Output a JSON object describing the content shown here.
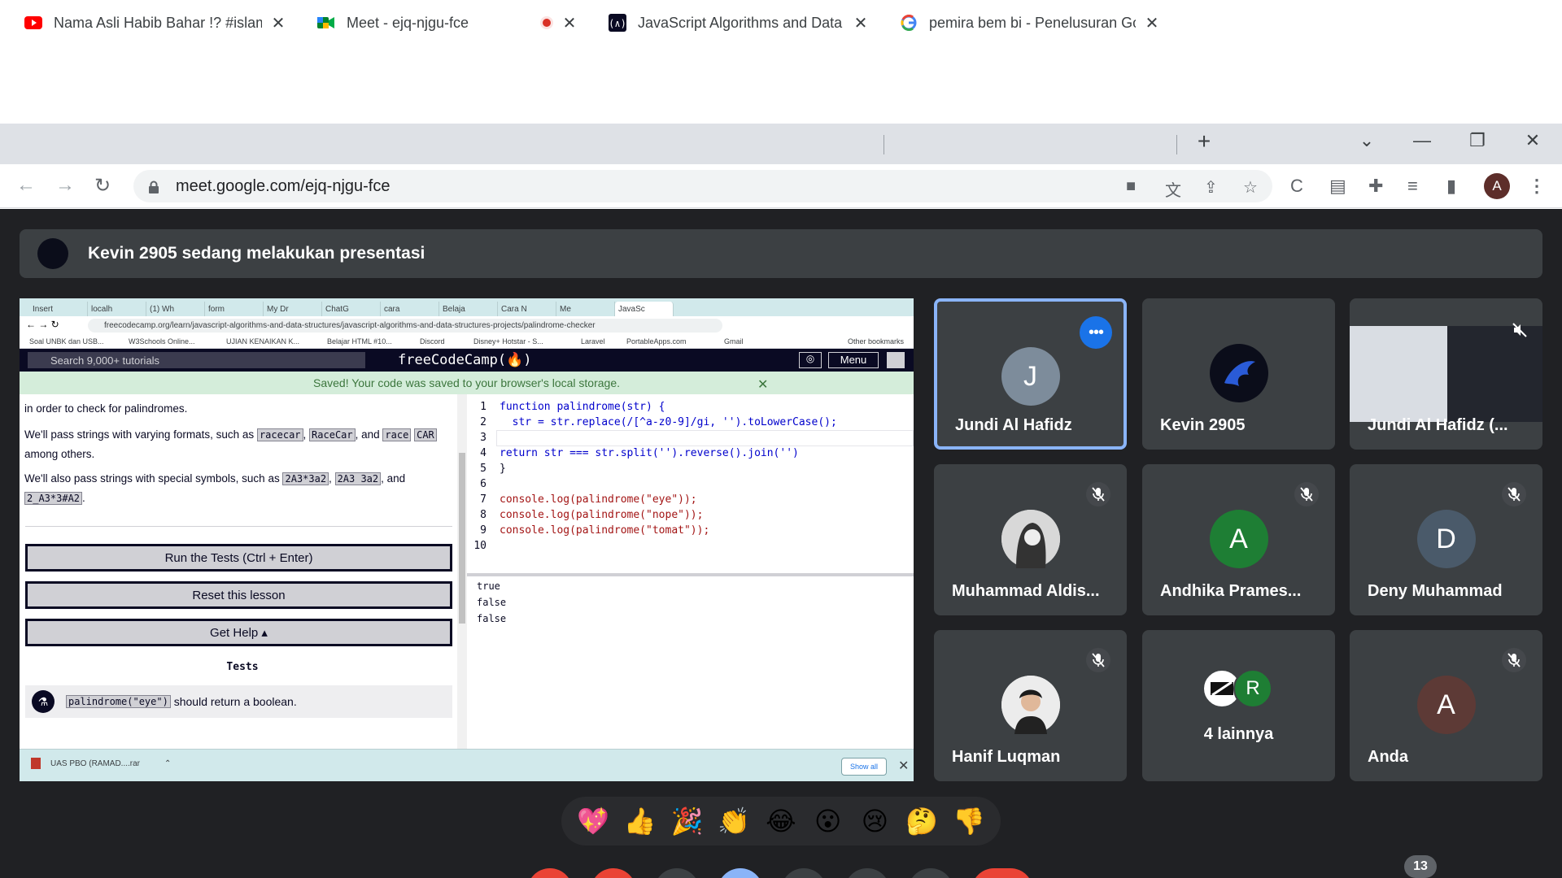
{
  "browser": {
    "tabs": [
      {
        "title": "Nama Asli Habib Bahar !? #islam",
        "icon": "youtube-icon"
      },
      {
        "title": "Meet - ejq-njgu-fce",
        "icon": "google-meet-icon",
        "recording": true
      },
      {
        "title": "JavaScript Algorithms and Data S",
        "icon": "freecodecamp-icon"
      },
      {
        "title": "pemira bem bi - Penelusuran Goo",
        "icon": "google-icon"
      }
    ],
    "url": "meet.google.com/ejq-njgu-fce",
    "profile_initial": "A"
  },
  "meet": {
    "presenting_banner": "Kevin 2905 sedang melakukan presentasi",
    "participants": [
      {
        "name": "Jundi Al Hafidz",
        "initial": "J",
        "color": "#7d8c9b",
        "speaking": true
      },
      {
        "name": "Kevin 2905",
        "initial": "",
        "color": "#0b0d1a"
      },
      {
        "name": "Jundi Al Hafidz (...",
        "initial": "",
        "color": "#2d2f3a",
        "muted": true
      },
      {
        "name": "Muhammad Aldis...",
        "initial": "",
        "color": "#cfcfcf",
        "muted": true
      },
      {
        "name": "Andhika Prames...",
        "initial": "A",
        "color": "#1e7e34",
        "muted": true
      },
      {
        "name": "Deny Muhammad",
        "initial": "D",
        "color": "#4a5a6a",
        "muted": true
      },
      {
        "name": "Hanif Luqman",
        "initial": "",
        "color": "#eaeaea",
        "muted": true
      },
      {
        "name": "4 lainnya",
        "initial": "R",
        "color": "#1e7e34"
      },
      {
        "name": "Anda",
        "initial": "A",
        "color": "#5d3a36",
        "muted": true
      }
    ],
    "reactions": [
      "💖",
      "👍",
      "🎉",
      "👏",
      "😂",
      "😮",
      "😢",
      "🤔",
      "👎"
    ],
    "participant_count": "13"
  },
  "shared_screen": {
    "tabs": [
      "Insert",
      "localh",
      "(1) Wh",
      "form",
      "My Dr",
      "ChatG",
      "cara",
      "Belaja",
      "Cara N",
      "Me",
      "JavaSc"
    ],
    "url": "freecodecamp.org/learn/javascript-algorithms-and-data-structures/javascript-algorithms-and-data-structures-projects/palindrome-checker",
    "bookmarks": [
      "Soal UNBK dan USB...",
      "W3Schools Online...",
      "UJIAN KENAIKAN K...",
      "Belajar HTML #10...",
      "Discord",
      "Disney+ Hotstar - S...",
      "Laravel",
      "PortableApps.com",
      "Gmail",
      "Other bookmarks"
    ],
    "search_placeholder": "Search 9,000+ tutorials",
    "logo": "freeCodeCamp(🔥)",
    "menu": "Menu",
    "flash": "Saved! Your code was saved to your browser's local storage.",
    "lesson_p1": "in order to check for palindromes.",
    "lesson_p2_a": "We'll pass strings with varying formats, such as",
    "lesson_p2_t1": "racecar",
    "lesson_p2_t2": "RaceCar",
    "lesson_p2_and": ", and",
    "lesson_p2_t3": "race",
    "lesson_p2_t4": "CAR",
    "lesson_p2_b": "among others.",
    "lesson_p3_a": "We'll also pass strings with special symbols, such as",
    "lesson_p3_t1": "2A3*3a2",
    "lesson_p3_t2": "2A3 3a2",
    "lesson_p3_and": ", and",
    "lesson_p3_t3": "2_A3*3#A2",
    "btn_run": "Run the Tests (Ctrl + Enter)",
    "btn_reset": "Reset this lesson",
    "btn_help": "Get Help ▴",
    "tests_heading": "Tests",
    "test1_code": "palindrome(\"eye\")",
    "test1_text": "should return a boolean.",
    "code_lines": [
      "function palindrome(str) {",
      "  str = str.replace(/[^a-z0-9]/gi, '').toLowerCase();",
      "",
      "return str === str.split('').reverse().join('')",
      "}",
      "",
      "console.log(palindrome(\"eye\"));",
      "console.log(palindrome(\"nope\"));",
      "console.log(palindrome(\"tomat\"));",
      ""
    ],
    "console_output": [
      "true",
      "false",
      "false"
    ],
    "download": "UAS PBO (RAMAD....rar",
    "show_all": "Show all"
  }
}
